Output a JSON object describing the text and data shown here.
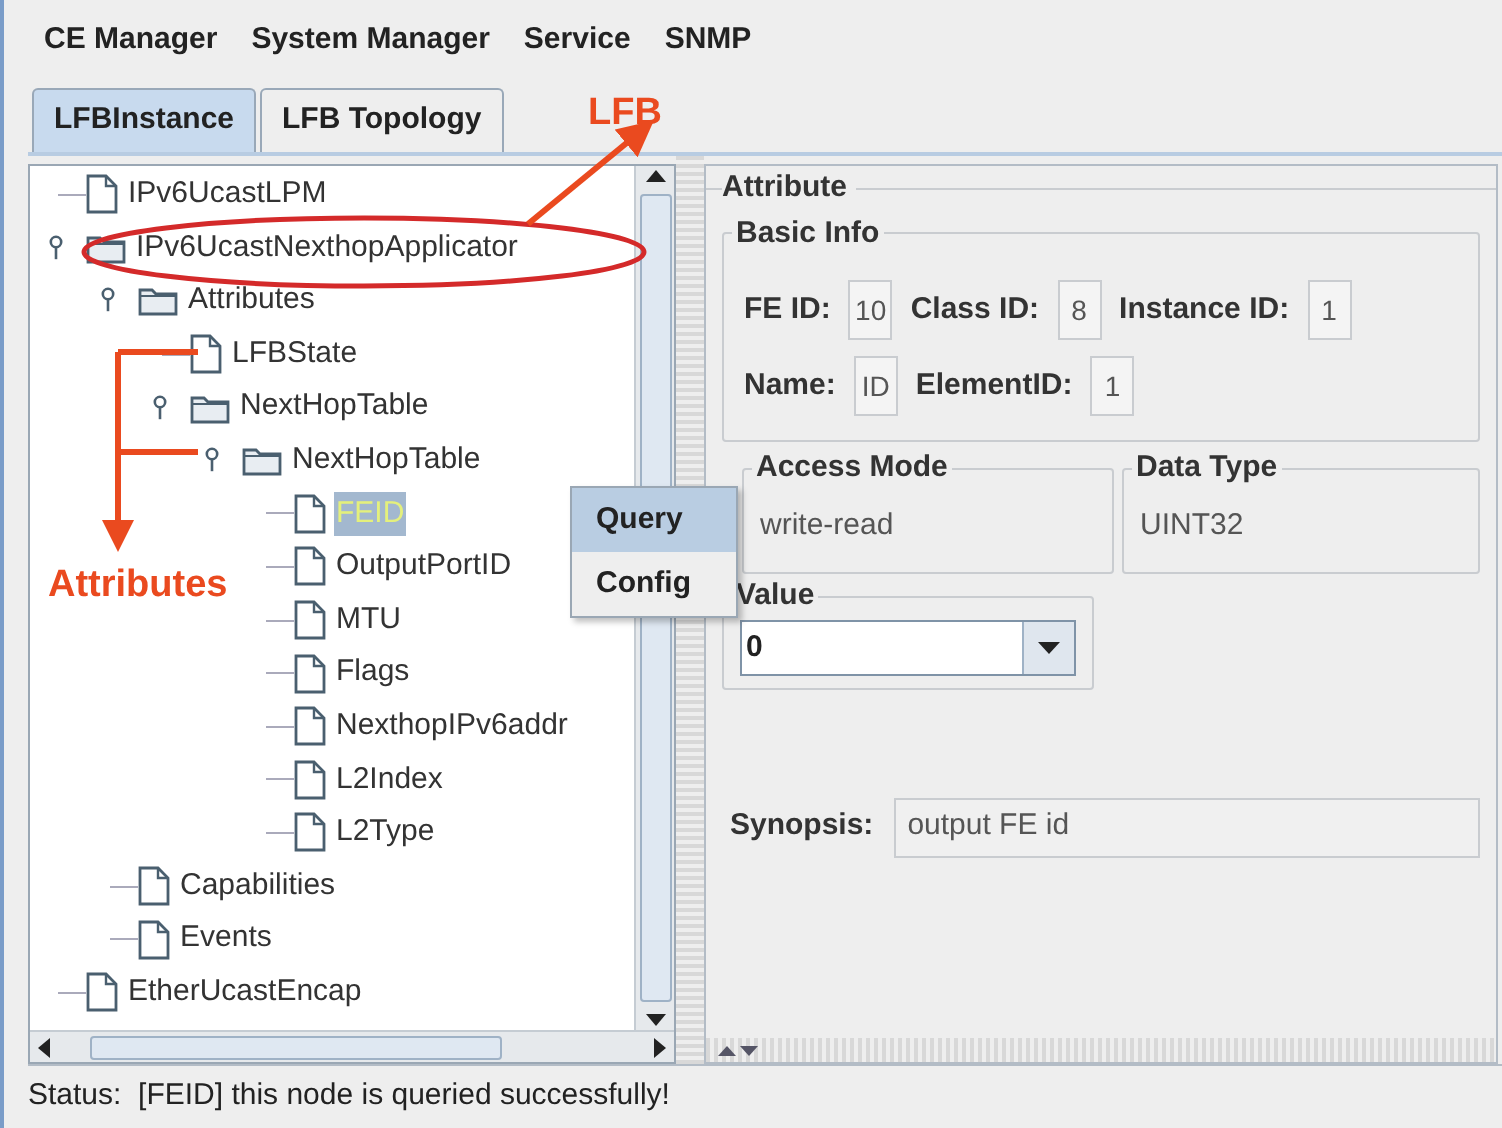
{
  "menu": [
    {
      "label": "CE Manager"
    },
    {
      "label": "System Manager"
    },
    {
      "label": "Service"
    },
    {
      "label": "SNMP"
    }
  ],
  "tabs": [
    {
      "label": "LFBInstance",
      "selected": true
    },
    {
      "label": "LFB Topology",
      "selected": false
    }
  ],
  "tree": [
    {
      "label": "IPv6UcastLPM",
      "kind": "file",
      "selected": false
    },
    {
      "label": "IPv6UcastNexthopApplicator",
      "kind": "folder",
      "expanded": true,
      "selected": false,
      "children": [
        {
          "label": "Attributes",
          "kind": "folder",
          "expanded": true,
          "selected": false,
          "children": [
            {
              "label": "LFBState",
              "kind": "file",
              "selected": false
            },
            {
              "label": "NextHopTable",
              "kind": "folder",
              "expanded": true,
              "selected": false,
              "children": [
                {
                  "label": "NextHopTable",
                  "kind": "folder",
                  "expanded": true,
                  "selected": false,
                  "children": [
                    {
                      "label": "FEID",
                      "kind": "file",
                      "selected": true
                    },
                    {
                      "label": "OutputPortID",
                      "kind": "file",
                      "selected": false
                    },
                    {
                      "label": "MTU",
                      "kind": "file",
                      "selected": false
                    },
                    {
                      "label": "Flags",
                      "kind": "file",
                      "selected": false
                    },
                    {
                      "label": "NexthopIPv6addr",
                      "kind": "file",
                      "selected": false
                    },
                    {
                      "label": "L2Index",
                      "kind": "file",
                      "selected": false
                    },
                    {
                      "label": "L2Type",
                      "kind": "file",
                      "selected": false
                    }
                  ]
                }
              ]
            }
          ]
        },
        {
          "label": "Capabilities",
          "kind": "file",
          "selected": false
        },
        {
          "label": "Events",
          "kind": "file",
          "selected": false
        }
      ]
    },
    {
      "label": "EtherUcastEncap",
      "kind": "file",
      "selected": false
    }
  ],
  "context_menu": [
    {
      "label": "Query",
      "selected": true
    },
    {
      "label": "Config",
      "selected": false
    }
  ],
  "attribute_panel": {
    "title": "Attribute",
    "basic_info": {
      "title": "Basic Info",
      "fields": [
        {
          "label": "FE ID:",
          "value": "10"
        },
        {
          "label": "Class ID:",
          "value": "8"
        },
        {
          "label": "Instance ID:",
          "value": "1"
        },
        {
          "label": "Name:",
          "value": "ID"
        },
        {
          "label": "ElementID:",
          "value": "1"
        }
      ]
    },
    "access_mode": {
      "title": "Access Mode",
      "value": "write-read"
    },
    "data_type": {
      "title": "Data Type",
      "value": "UINT32"
    },
    "value": {
      "title": "Value",
      "value": "0"
    },
    "synopsis": {
      "label": "Synopsis:",
      "value": "output FE id"
    }
  },
  "annotations": [
    {
      "text": "LFB"
    },
    {
      "text": "Attributes"
    }
  ],
  "status_bar": "Status:  [FEID] this node is queried successfully!"
}
